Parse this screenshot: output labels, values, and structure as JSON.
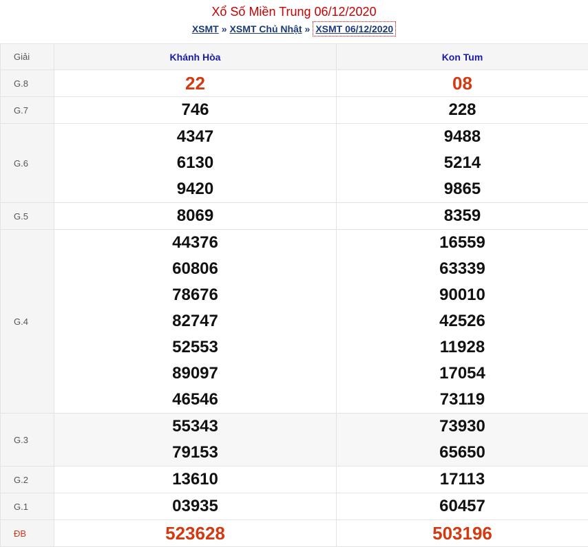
{
  "header": {
    "title": "Xổ Số Miền Trung 06/12/2020",
    "breadcrumb": {
      "item1": "XSMT",
      "sep": "»",
      "item2": "XSMT Chủ Nhật",
      "item3": "XSMT 06/12/2020"
    }
  },
  "table": {
    "col_prize": "Giải",
    "col_a": "Khánh Hòa",
    "col_b": "Kon Tum",
    "rows": [
      {
        "prize": "G.8",
        "a": [
          "22"
        ],
        "b": [
          "08"
        ]
      },
      {
        "prize": "G.7",
        "a": [
          "746"
        ],
        "b": [
          "228"
        ]
      },
      {
        "prize": "G.6",
        "a": [
          "4347",
          "6130",
          "9420"
        ],
        "b": [
          "9488",
          "5214",
          "9865"
        ]
      },
      {
        "prize": "G.5",
        "a": [
          "8069"
        ],
        "b": [
          "8359"
        ]
      },
      {
        "prize": "G.4",
        "a": [
          "44376",
          "60806",
          "78676",
          "82747",
          "52553",
          "89097",
          "46546"
        ],
        "b": [
          "16559",
          "63339",
          "90010",
          "42526",
          "11928",
          "17054",
          "73119"
        ]
      },
      {
        "prize": "G.3",
        "a": [
          "55343",
          "79153"
        ],
        "b": [
          "73930",
          "65650"
        ]
      },
      {
        "prize": "G.2",
        "a": [
          "13610"
        ],
        "b": [
          "17113"
        ]
      },
      {
        "prize": "G.1",
        "a": [
          "03935"
        ],
        "b": [
          "60457"
        ]
      },
      {
        "prize": "ĐB",
        "a": [
          "523628"
        ],
        "b": [
          "503196"
        ]
      }
    ]
  },
  "colors": {
    "title_red": "#c80000",
    "number_red": "#d43a12",
    "header_blue": "#1a1aa8",
    "link_blue": "#1a3a7a"
  }
}
